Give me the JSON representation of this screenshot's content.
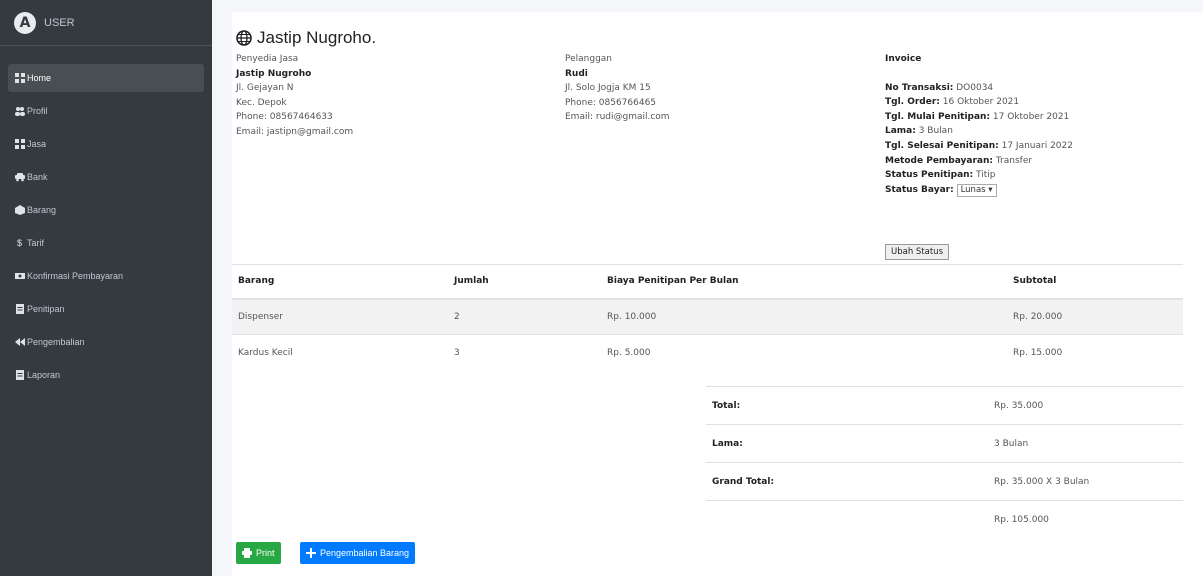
{
  "sidebar": {
    "brand": "USER",
    "items": [
      {
        "icon": "grid-icon",
        "label": "Home"
      },
      {
        "icon": "users-icon",
        "label": "Profil"
      },
      {
        "icon": "grid-icon",
        "label": "Jasa"
      },
      {
        "icon": "car-icon",
        "label": "Bank"
      },
      {
        "icon": "box-icon",
        "label": "Barang"
      },
      {
        "icon": "dollar-icon",
        "label": "Tarif"
      },
      {
        "icon": "money-icon",
        "label": "Konfirmasi Pembayaran"
      },
      {
        "icon": "file-icon",
        "label": "Penitipan"
      },
      {
        "icon": "rewind-icon",
        "label": "Pengembalian"
      },
      {
        "icon": "file-icon",
        "label": "Laporan"
      }
    ]
  },
  "header": {
    "title": "Jastip Nugroho."
  },
  "seller": {
    "heading": "Penyedia Jasa",
    "name": "Jastip Nugroho",
    "address": "Jl. Gejayan N",
    "district": "Kec. Depok",
    "phone": "Phone: 08567464633",
    "email": "Email: jastipn@gmail.com"
  },
  "customer": {
    "heading": "Pelanggan",
    "name": "Rudi",
    "address": "Jl. Solo Jogja KM 15",
    "phone": "Phone: 0856766465",
    "email": "Email: rudi@gmail.com"
  },
  "invoice": {
    "heading": "Invoice",
    "transaction_label": "No Transaksi:",
    "transaction_value": " DO0034",
    "order_label": "Tgl. Order:",
    "order_value": " 16 Oktober 2021",
    "start_label": "Tgl. Mulai Penitipan:",
    "start_value": " 17 Oktober 2021",
    "duration_label": "Lama:",
    "duration_value": " 3 Bulan",
    "end_label": "Tgl. Selesai Penitipan:",
    "end_value": " 17 Januari 2022",
    "method_label": "Metode Pembayaran:",
    "method_value": " Transfer",
    "status_label": "Status Penitipan:",
    "status_value": " Titip",
    "pay_status_label": "Status Bayar:",
    "pay_status_value": "Lunas ▾",
    "change_status_button": "Ubah Status"
  },
  "table": {
    "headers": [
      "Barang",
      "Jumlah",
      "Biaya Penitipan Per Bulan",
      "Subtotal"
    ],
    "rows": [
      [
        "Dispenser",
        "2",
        "Rp. 10.000",
        "Rp. 20.000"
      ],
      [
        "Kardus Kecil",
        "3",
        "Rp. 5.000",
        "Rp. 15.000"
      ]
    ]
  },
  "totals": {
    "total_label": "Total:",
    "total_value": "Rp. 35.000",
    "lama_label": "Lama:",
    "lama_value": "3 Bulan",
    "grand_label": "Grand Total:",
    "grand_value": "Rp. 35.000 X 3 Bulan",
    "final_value": "Rp. 105.000"
  },
  "buttons": {
    "print": "Print",
    "return": "Pengembalian Barang"
  }
}
